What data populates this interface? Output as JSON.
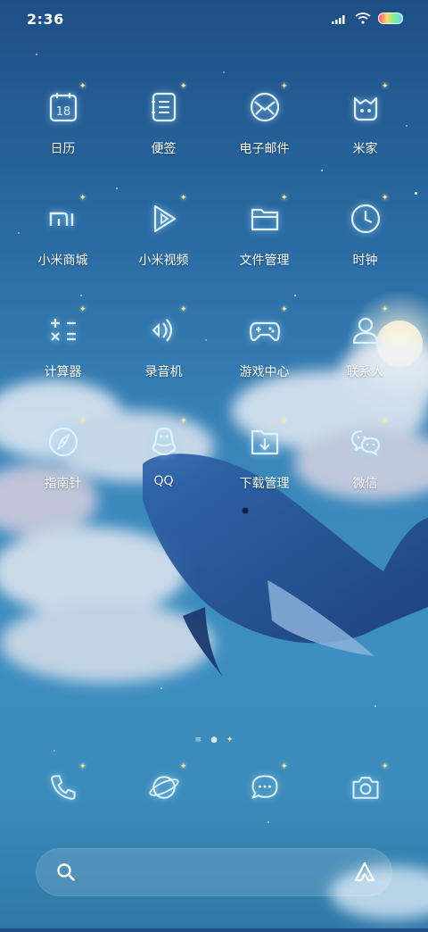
{
  "status_bar": {
    "time": "2:36"
  },
  "apps": [
    {
      "name": "calendar",
      "label": "日历",
      "icon": "calendar-icon",
      "day": "18"
    },
    {
      "name": "notes",
      "label": "便签",
      "icon": "notes-icon"
    },
    {
      "name": "email",
      "label": "电子邮件",
      "icon": "email-icon"
    },
    {
      "name": "mi-home",
      "label": "米家",
      "icon": "mi-home-icon"
    },
    {
      "name": "mi-store",
      "label": "小米商城",
      "icon": "mi-logo-icon"
    },
    {
      "name": "mi-video",
      "label": "小米视频",
      "icon": "play-icon"
    },
    {
      "name": "file-manager",
      "label": "文件管理",
      "icon": "folder-icon"
    },
    {
      "name": "clock",
      "label": "时钟",
      "icon": "clock-icon"
    },
    {
      "name": "calculator",
      "label": "计算器",
      "icon": "calculator-icon"
    },
    {
      "name": "recorder",
      "label": "录音机",
      "icon": "recorder-icon"
    },
    {
      "name": "game-center",
      "label": "游戏中心",
      "icon": "gamepad-icon"
    },
    {
      "name": "contacts",
      "label": "联系人",
      "icon": "contact-icon"
    },
    {
      "name": "compass",
      "label": "指南针",
      "icon": "compass-icon"
    },
    {
      "name": "qq",
      "label": "QQ",
      "icon": "qq-penguin-icon"
    },
    {
      "name": "downloads",
      "label": "下载管理",
      "icon": "download-icon"
    },
    {
      "name": "wechat",
      "label": "微信",
      "icon": "wechat-icon"
    }
  ],
  "dock": [
    {
      "name": "phone",
      "icon": "phone-icon"
    },
    {
      "name": "browser",
      "icon": "planet-icon"
    },
    {
      "name": "messages",
      "icon": "message-icon"
    },
    {
      "name": "camera",
      "icon": "camera-icon"
    }
  ],
  "search": {
    "left_icon": "search-icon",
    "right_icon": "assistant-icon"
  },
  "colors": {
    "icon_stroke": "#dff3ff",
    "glow": "#a0dcff",
    "sparkle": "#ffe98a"
  }
}
